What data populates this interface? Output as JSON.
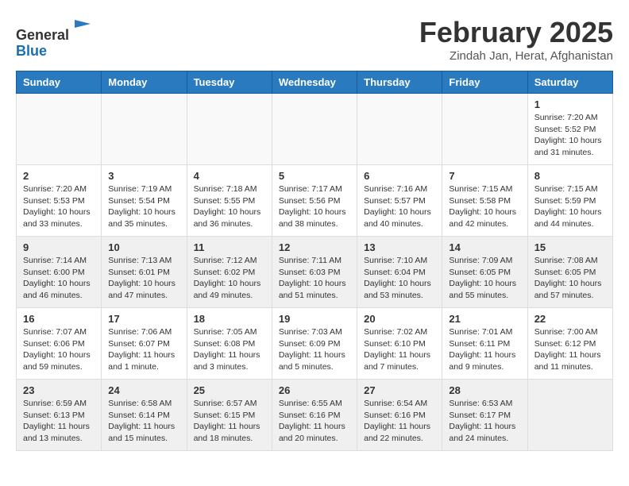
{
  "header": {
    "logo_line1": "General",
    "logo_line2": "Blue",
    "month": "February 2025",
    "location": "Zindah Jan, Herat, Afghanistan"
  },
  "weekdays": [
    "Sunday",
    "Monday",
    "Tuesday",
    "Wednesday",
    "Thursday",
    "Friday",
    "Saturday"
  ],
  "weeks": [
    {
      "shaded": false,
      "days": [
        {
          "num": "",
          "info": ""
        },
        {
          "num": "",
          "info": ""
        },
        {
          "num": "",
          "info": ""
        },
        {
          "num": "",
          "info": ""
        },
        {
          "num": "",
          "info": ""
        },
        {
          "num": "",
          "info": ""
        },
        {
          "num": "1",
          "info": "Sunrise: 7:20 AM\nSunset: 5:52 PM\nDaylight: 10 hours and 31 minutes."
        }
      ]
    },
    {
      "shaded": false,
      "days": [
        {
          "num": "2",
          "info": "Sunrise: 7:20 AM\nSunset: 5:53 PM\nDaylight: 10 hours and 33 minutes."
        },
        {
          "num": "3",
          "info": "Sunrise: 7:19 AM\nSunset: 5:54 PM\nDaylight: 10 hours and 35 minutes."
        },
        {
          "num": "4",
          "info": "Sunrise: 7:18 AM\nSunset: 5:55 PM\nDaylight: 10 hours and 36 minutes."
        },
        {
          "num": "5",
          "info": "Sunrise: 7:17 AM\nSunset: 5:56 PM\nDaylight: 10 hours and 38 minutes."
        },
        {
          "num": "6",
          "info": "Sunrise: 7:16 AM\nSunset: 5:57 PM\nDaylight: 10 hours and 40 minutes."
        },
        {
          "num": "7",
          "info": "Sunrise: 7:15 AM\nSunset: 5:58 PM\nDaylight: 10 hours and 42 minutes."
        },
        {
          "num": "8",
          "info": "Sunrise: 7:15 AM\nSunset: 5:59 PM\nDaylight: 10 hours and 44 minutes."
        }
      ]
    },
    {
      "shaded": true,
      "days": [
        {
          "num": "9",
          "info": "Sunrise: 7:14 AM\nSunset: 6:00 PM\nDaylight: 10 hours and 46 minutes."
        },
        {
          "num": "10",
          "info": "Sunrise: 7:13 AM\nSunset: 6:01 PM\nDaylight: 10 hours and 47 minutes."
        },
        {
          "num": "11",
          "info": "Sunrise: 7:12 AM\nSunset: 6:02 PM\nDaylight: 10 hours and 49 minutes."
        },
        {
          "num": "12",
          "info": "Sunrise: 7:11 AM\nSunset: 6:03 PM\nDaylight: 10 hours and 51 minutes."
        },
        {
          "num": "13",
          "info": "Sunrise: 7:10 AM\nSunset: 6:04 PM\nDaylight: 10 hours and 53 minutes."
        },
        {
          "num": "14",
          "info": "Sunrise: 7:09 AM\nSunset: 6:05 PM\nDaylight: 10 hours and 55 minutes."
        },
        {
          "num": "15",
          "info": "Sunrise: 7:08 AM\nSunset: 6:05 PM\nDaylight: 10 hours and 57 minutes."
        }
      ]
    },
    {
      "shaded": false,
      "days": [
        {
          "num": "16",
          "info": "Sunrise: 7:07 AM\nSunset: 6:06 PM\nDaylight: 10 hours and 59 minutes."
        },
        {
          "num": "17",
          "info": "Sunrise: 7:06 AM\nSunset: 6:07 PM\nDaylight: 11 hours and 1 minute."
        },
        {
          "num": "18",
          "info": "Sunrise: 7:05 AM\nSunset: 6:08 PM\nDaylight: 11 hours and 3 minutes."
        },
        {
          "num": "19",
          "info": "Sunrise: 7:03 AM\nSunset: 6:09 PM\nDaylight: 11 hours and 5 minutes."
        },
        {
          "num": "20",
          "info": "Sunrise: 7:02 AM\nSunset: 6:10 PM\nDaylight: 11 hours and 7 minutes."
        },
        {
          "num": "21",
          "info": "Sunrise: 7:01 AM\nSunset: 6:11 PM\nDaylight: 11 hours and 9 minutes."
        },
        {
          "num": "22",
          "info": "Sunrise: 7:00 AM\nSunset: 6:12 PM\nDaylight: 11 hours and 11 minutes."
        }
      ]
    },
    {
      "shaded": true,
      "days": [
        {
          "num": "23",
          "info": "Sunrise: 6:59 AM\nSunset: 6:13 PM\nDaylight: 11 hours and 13 minutes."
        },
        {
          "num": "24",
          "info": "Sunrise: 6:58 AM\nSunset: 6:14 PM\nDaylight: 11 hours and 15 minutes."
        },
        {
          "num": "25",
          "info": "Sunrise: 6:57 AM\nSunset: 6:15 PM\nDaylight: 11 hours and 18 minutes."
        },
        {
          "num": "26",
          "info": "Sunrise: 6:55 AM\nSunset: 6:16 PM\nDaylight: 11 hours and 20 minutes."
        },
        {
          "num": "27",
          "info": "Sunrise: 6:54 AM\nSunset: 6:16 PM\nDaylight: 11 hours and 22 minutes."
        },
        {
          "num": "28",
          "info": "Sunrise: 6:53 AM\nSunset: 6:17 PM\nDaylight: 11 hours and 24 minutes."
        },
        {
          "num": "",
          "info": ""
        }
      ]
    }
  ]
}
